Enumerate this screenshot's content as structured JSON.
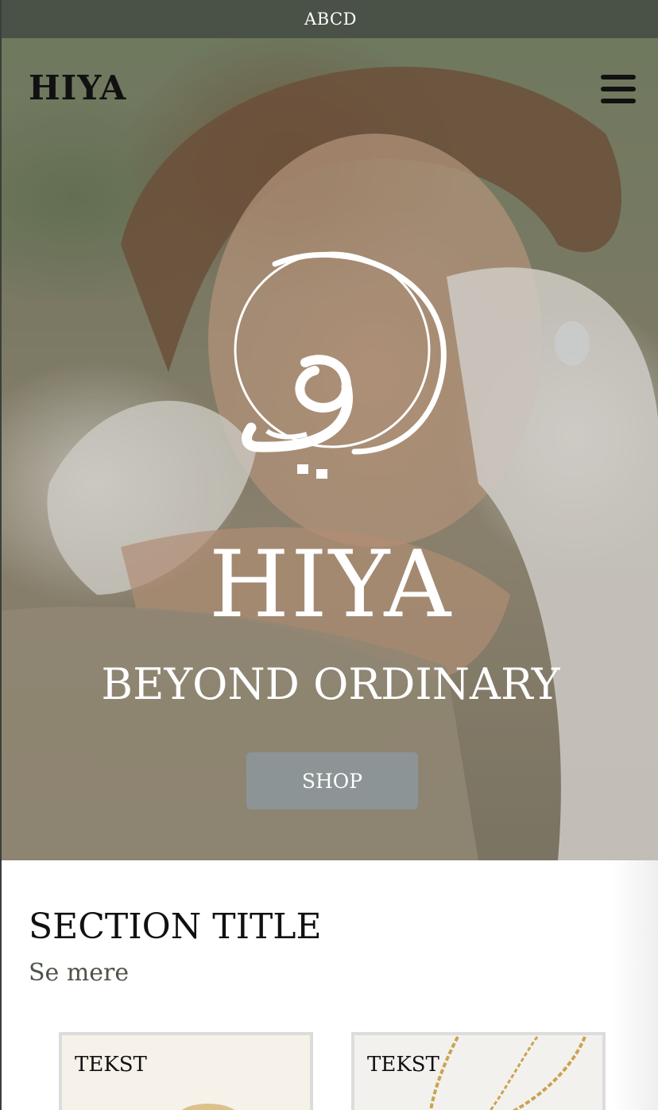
{
  "announcement": {
    "text": "ABCD"
  },
  "header": {
    "logo": "HIYA",
    "menu_icon": "hamburger-menu-icon"
  },
  "hero": {
    "brand_mark_icon": "hiya-arabic-calligraphy-logo",
    "title": "HIYA",
    "subtitle": "BEYOND ORDINARY",
    "cta_label": "SHOP",
    "colors": {
      "cta_background": "#8c9496",
      "text": "#ffffff"
    }
  },
  "section": {
    "title": "SECTION TITLE",
    "link": "Se mere",
    "cards": [
      {
        "label": "TEKST",
        "image": "gold-ring"
      },
      {
        "label": "TEKST",
        "image": "gold-chain-necklace"
      }
    ]
  },
  "colors": {
    "announcement_bar": "#4a5147",
    "link": "#4d5448"
  }
}
